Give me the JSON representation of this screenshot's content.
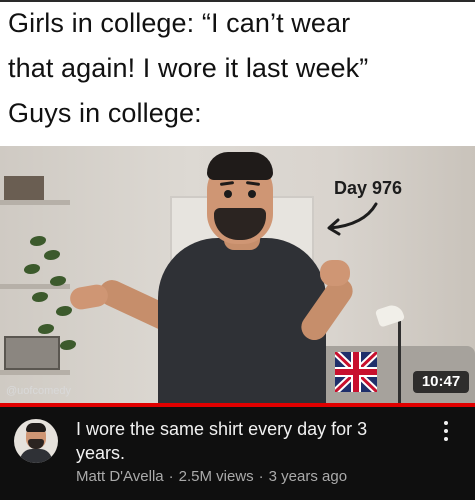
{
  "caption": {
    "line1": "Girls in college: “I can’t wear",
    "line2": "that again! I wore it last week”",
    "line3": "Guys in college:"
  },
  "thumbnail": {
    "annotation": "Day 976",
    "watermark": "@uofcomedy",
    "duration": "10:47"
  },
  "video": {
    "title": "I wore the same shirt every day for 3 years.",
    "channel": "Matt D'Avella",
    "views": "2.5M views",
    "age": "3 years ago",
    "menu_icon": "more-vert-icon"
  },
  "colors": {
    "progress_bar": "#e00000",
    "info_background": "#0f0f0f",
    "title_text": "#f1f1f1",
    "meta_text": "#aaaaaa"
  }
}
